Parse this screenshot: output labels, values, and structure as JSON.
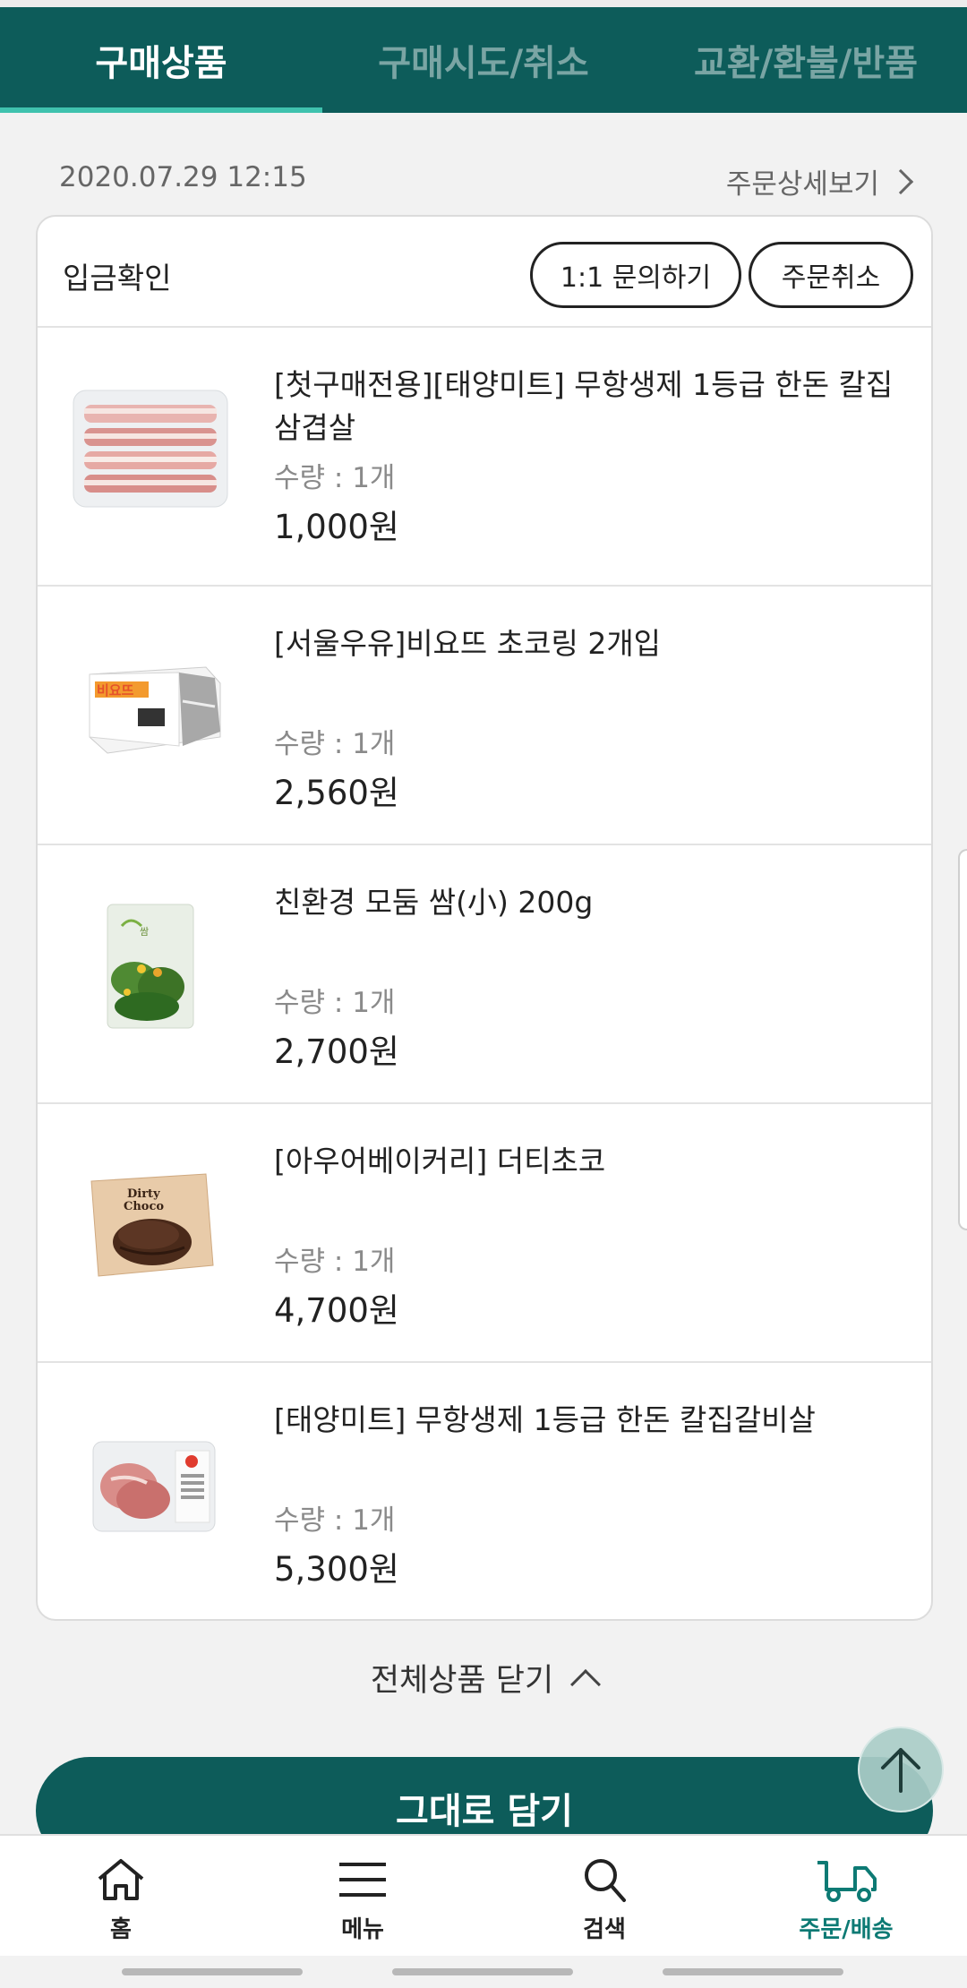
{
  "tabs": [
    {
      "label": "구매상품",
      "active": true
    },
    {
      "label": "구매시도/취소",
      "active": false
    },
    {
      "label": "교환/환불/반품",
      "active": false
    }
  ],
  "order": {
    "date": "2020.07.29 12:15",
    "detail_link": "주문상세보기",
    "status": "입금확인",
    "inquiry_button": "1:1 문의하기",
    "cancel_button": "주문취소"
  },
  "items": [
    {
      "name": "[첫구매전용][태양미트] 무항생제 1등급 한돈 칼집삼겹살",
      "qty": "수량 : 1개",
      "price": "1,000원"
    },
    {
      "name": "[서울우유]비요뜨 초코링 2개입",
      "qty": "수량 : 1개",
      "price": "2,560원"
    },
    {
      "name": "친환경 모둠 쌈(小) 200g",
      "qty": "수량 : 1개",
      "price": "2,700원"
    },
    {
      "name": "[아우어베이커리] 더티초코",
      "qty": "수량 : 1개",
      "price": "4,700원"
    },
    {
      "name": "[태양미트] 무항생제 1등급 한돈 칼집갈비살",
      "qty": "수량 : 1개",
      "price": "5,300원"
    }
  ],
  "close_all_label": "전체상품 닫기",
  "add_button_label": "그대로 담기",
  "nav": [
    {
      "label": "홈",
      "icon": "home-icon",
      "active": false
    },
    {
      "label": "메뉴",
      "icon": "menu-icon",
      "active": false
    },
    {
      "label": "검색",
      "icon": "search-icon",
      "active": false
    },
    {
      "label": "주문/배송",
      "icon": "delivery-truck-icon",
      "active": true
    }
  ],
  "colors": {
    "brand": "#0d5c5a",
    "tab_indicator": "#3fc2ae",
    "nav_active": "#0d7a74"
  }
}
